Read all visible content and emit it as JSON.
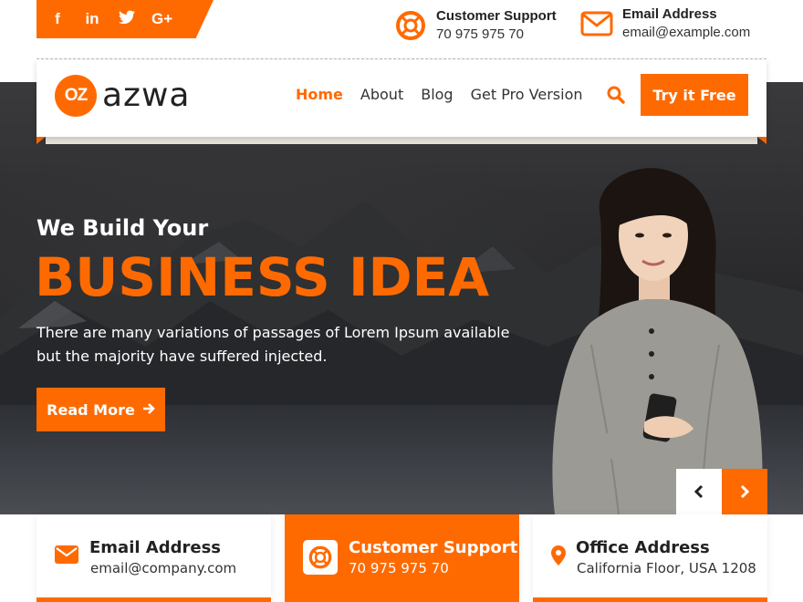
{
  "social": [
    {
      "name": "facebook",
      "glyph": "f"
    },
    {
      "name": "linkedin",
      "glyph": "in"
    },
    {
      "name": "twitter",
      "glyph": "🐦"
    },
    {
      "name": "google-plus",
      "glyph": "G+"
    }
  ],
  "header_contacts": {
    "support": {
      "title": "Customer Support",
      "value": "70 975 975 70"
    },
    "email": {
      "title": "Email Address",
      "value": "email@example.com"
    }
  },
  "logo": {
    "mark": "OZ",
    "text": "azwa"
  },
  "menu": [
    {
      "label": "Home",
      "active": true
    },
    {
      "label": "About",
      "active": false
    },
    {
      "label": "Blog",
      "active": false
    },
    {
      "label": "Get Pro Version",
      "active": false
    }
  ],
  "try_button": "Try it Free",
  "hero": {
    "subtitle": "We Build Your",
    "title": "BUSINESS IDEA",
    "description": "There are many variations of passages of Lorem Ipsum available but the majority have suffered injected.",
    "button": "Read More"
  },
  "cards": [
    {
      "title": "Email Address",
      "value": "email@company.com"
    },
    {
      "title": "Customer Support",
      "value": "70 975 975 70"
    },
    {
      "title": "Office Address",
      "value": "California Floor, USA 1208"
    }
  ],
  "colors": {
    "accent": "#ff6a00",
    "text": "#222222"
  }
}
